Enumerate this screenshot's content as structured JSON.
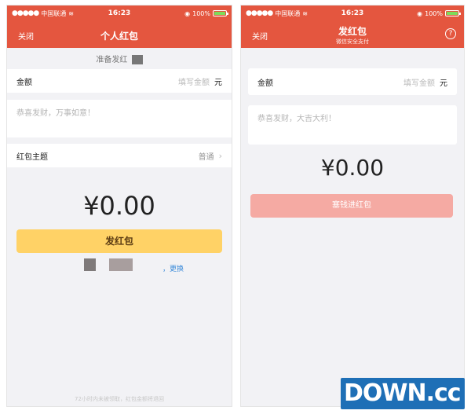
{
  "left": {
    "status": {
      "carrier": "中国联通",
      "time": "16:23",
      "battery": "100%"
    },
    "nav": {
      "close": "关闭",
      "title": "个人红包"
    },
    "prepare_text": "准备发红",
    "amount_row": {
      "label": "金额",
      "placeholder": "填写金额",
      "unit": "元"
    },
    "message_placeholder": "恭喜发财，万事如意！",
    "theme_row": {
      "label": "红包主题",
      "value": "普通"
    },
    "amount_display": "¥0.00",
    "send_button": "发红包",
    "change_link": "更换",
    "footer_note": "72小时内未被领取，红包金额将退回"
  },
  "right": {
    "status": {
      "carrier": "中国联通",
      "time": "16:23",
      "battery": "100%"
    },
    "nav": {
      "close": "关闭",
      "title": "发红包",
      "subtitle": "微信安全支付",
      "help": "?"
    },
    "amount_row": {
      "label": "金额",
      "placeholder": "填写金额",
      "unit": "元"
    },
    "message_placeholder": "恭喜发财，大吉大利！",
    "amount_display": "¥0.00",
    "submit_button": "塞钱进红包"
  },
  "watermark": "DOWN.cc",
  "colors": {
    "nav_red": "#e4563f",
    "send_yellow": "#ffd266",
    "submit_pink": "#f5aaa3",
    "link_blue": "#3a8ad9"
  }
}
